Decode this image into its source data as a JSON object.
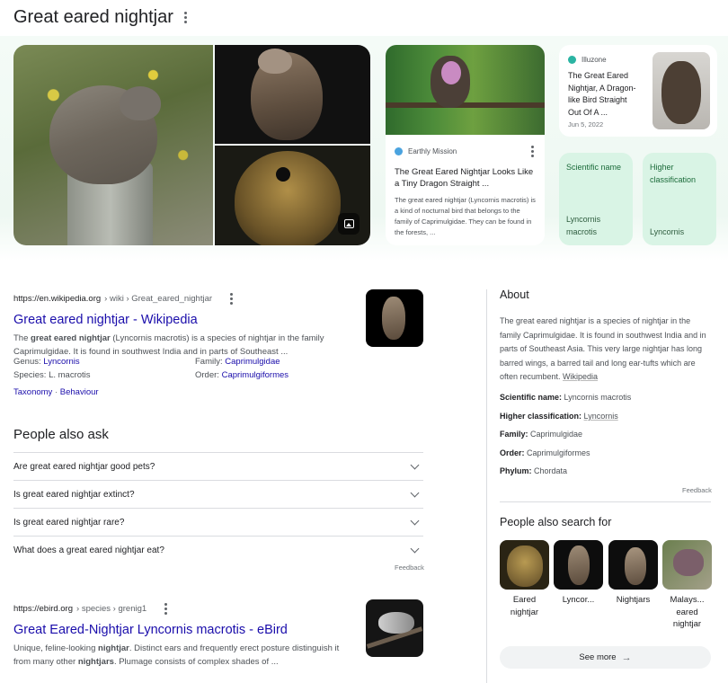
{
  "header": {
    "title": "Great eared nightjar"
  },
  "articles": [
    {
      "source": "Earthly Mission",
      "title": "The Great Eared Nightjar Looks Like a Tiny Dragon Straight ...",
      "snippet": "The great eared nightjar (Lyncornis macrotis) is a kind of nocturnal bird that belongs to the family of Caprimulgidae. They can be found in the forests, ..."
    },
    {
      "source": "Illuzone",
      "title": "The Great Eared Nightjar, A Dragon-like Bird Straight Out Of A ...",
      "date": "Jun 5, 2022"
    }
  ],
  "facts": [
    {
      "label": "Scientific name",
      "value": "Lyncornis macrotis"
    },
    {
      "label": "Higher classification",
      "value": "Lyncornis"
    }
  ],
  "wiki": {
    "domain": "https://en.wikipedia.org",
    "path": "› wiki › Great_eared_nightjar",
    "title": "Great eared nightjar - Wikipedia",
    "snippet_pre": "The ",
    "snippet_bold": "great eared nightjar",
    "snippet_post": " (Lyncornis macrotis) is a species of nightjar in the family Caprimulgidae. It is found in southwest India and in parts of Southeast ...",
    "genus_label": "Genus:",
    "genus_value": "Lyncornis",
    "species_label": "Species:",
    "species_value": "L. macrotis",
    "family_label": "Family:",
    "family_value": "Caprimulgidae",
    "order_label": "Order:",
    "order_value": "Caprimulgiformes",
    "links": [
      "Taxonomy",
      "Behaviour"
    ],
    "link_sep": "·"
  },
  "paa": {
    "heading": "People also ask",
    "questions": [
      "Are great eared nightjar good pets?",
      "Is great eared nightjar extinct?",
      "Is great eared nightjar rare?",
      "What does a great eared nightjar eat?"
    ],
    "feedback": "Feedback"
  },
  "ebird": {
    "domain": "https://ebird.org",
    "path": "› species › grenig1",
    "title": "Great Eared-Nightjar Lyncornis macrotis - eBird",
    "snippet_1": "Unique, feline-looking ",
    "snippet_b1": "nightjar",
    "snippet_2": ". Distinct ears and frequently erect posture distinguish it from many other ",
    "snippet_b2": "nightjars",
    "snippet_3": ". Plumage consists of complex shades of ..."
  },
  "about": {
    "heading": "About",
    "text": "The great eared nightjar is a species of nightjar in the family Caprimulgidae. It is found in southwest India and in parts of Southeast Asia. This very large nightjar has long barred wings, a barred tail and long ear-tufts which are often recumbent. ",
    "source_link": "Wikipedia",
    "facts": [
      {
        "k": "Scientific name:",
        "v": "Lyncornis macrotis"
      },
      {
        "k": "Higher classification:",
        "v": "Lyncornis"
      },
      {
        "k": "Family:",
        "v": "Caprimulgidae"
      },
      {
        "k": "Order:",
        "v": "Caprimulgiformes"
      },
      {
        "k": "Phylum:",
        "v": "Chordata"
      }
    ],
    "feedback": "Feedback"
  },
  "also_search": {
    "heading": "People also search for",
    "items": [
      "Eared nightjar",
      "Lyncor...",
      "Nightjars",
      "Malays... eared nightjar"
    ],
    "see_more": "See more"
  }
}
